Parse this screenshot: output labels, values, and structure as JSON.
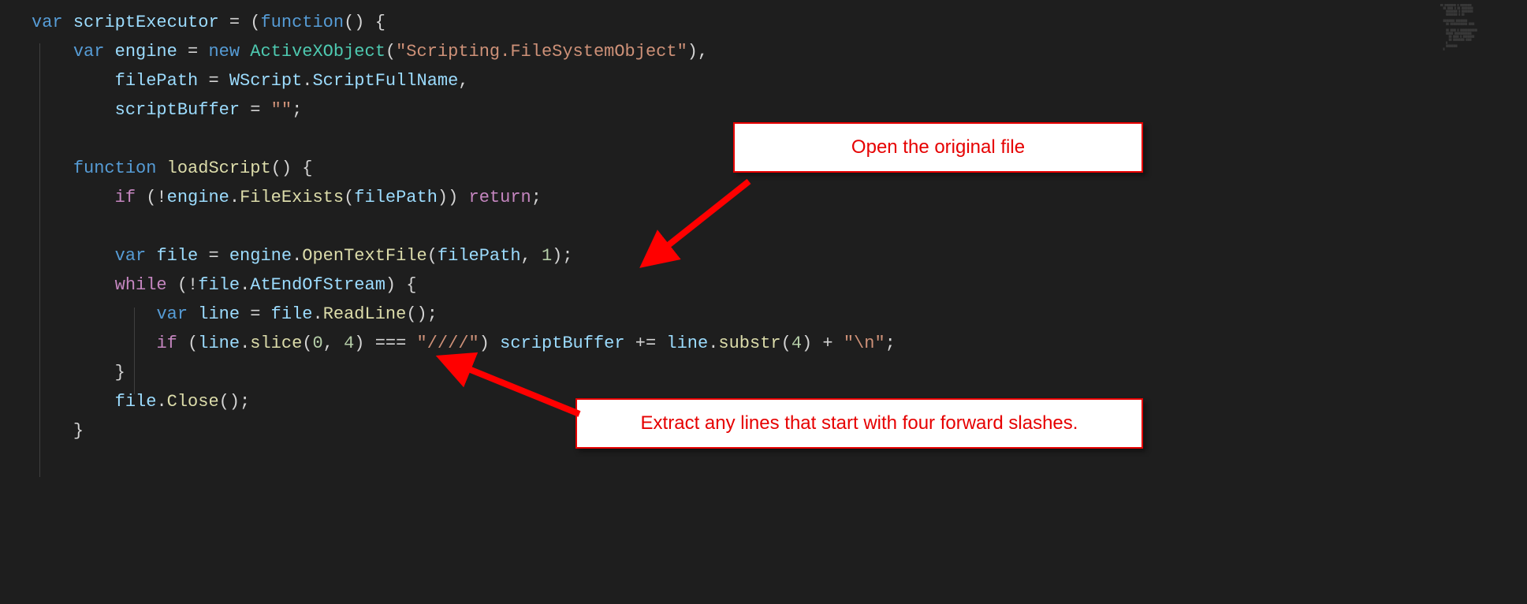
{
  "callouts": {
    "c1": "Open the original file",
    "c2": "Extract any lines that start with four forward slashes."
  },
  "code": {
    "l1": {
      "kw": "var",
      "name": "scriptExecutor",
      "eq": " = (",
      "fn": "function",
      "paren": "() {"
    },
    "l2": {
      "kw": "var",
      "name": "engine",
      "eq": " = ",
      "nw": "new",
      "type": "ActiveXObject",
      "open": "(",
      "str": "\"Scripting.FileSystemObject\"",
      "close": "),"
    },
    "l3": {
      "name": "filePath",
      "eq": " = ",
      "obj1": "WScript",
      "dot": ".",
      "obj2": "ScriptFullName",
      "end": ","
    },
    "l4": {
      "name": "scriptBuffer",
      "eq": " = ",
      "str": "\"\"",
      "end": ";"
    },
    "l6": {
      "kw": "function",
      "name": "loadScript",
      "paren": "() {"
    },
    "l7": {
      "ctrl": "if",
      "open": " (!",
      "obj": "engine",
      "dot": ".",
      "fn": "FileExists",
      "p1": "(",
      "arg": "filePath",
      "p2": ")) ",
      "ret": "return",
      "end": ";"
    },
    "l9": {
      "kw": "var",
      "name": "file",
      "eq": " = ",
      "obj": "engine",
      "dot": ".",
      "fn": "OpenTextFile",
      "p1": "(",
      "arg1": "filePath",
      "comma": ", ",
      "arg2": "1",
      "p2": ");"
    },
    "l10": {
      "ctrl": "while",
      "open": " (!",
      "obj": "file",
      "dot": ".",
      "prop": "AtEndOfStream",
      "close": ") {"
    },
    "l11": {
      "kw": "var",
      "name": "line",
      "eq": " = ",
      "obj": "file",
      "dot": ".",
      "fn": "ReadLine",
      "paren": "();"
    },
    "l12": {
      "ctrl": "if",
      "open": " (",
      "obj": "line",
      "dot": ".",
      "fn": "slice",
      "p1": "(",
      "a1": "0",
      "c": ", ",
      "a2": "4",
      "p2": ") === ",
      "str1": "\"////\"",
      "mid": ") ",
      "obj2": "scriptBuffer",
      "op": " += ",
      "obj3": "line",
      "dot2": ".",
      "fn2": "substr",
      "p3": "(",
      "a3": "4",
      "p4": ") + ",
      "str2": "\"\\n\"",
      "end": ";"
    },
    "l13": {
      "brace": "}"
    },
    "l14": {
      "obj": "file",
      "dot": ".",
      "fn": "Close",
      "paren": "();"
    },
    "l15": {
      "brace": "}"
    }
  }
}
